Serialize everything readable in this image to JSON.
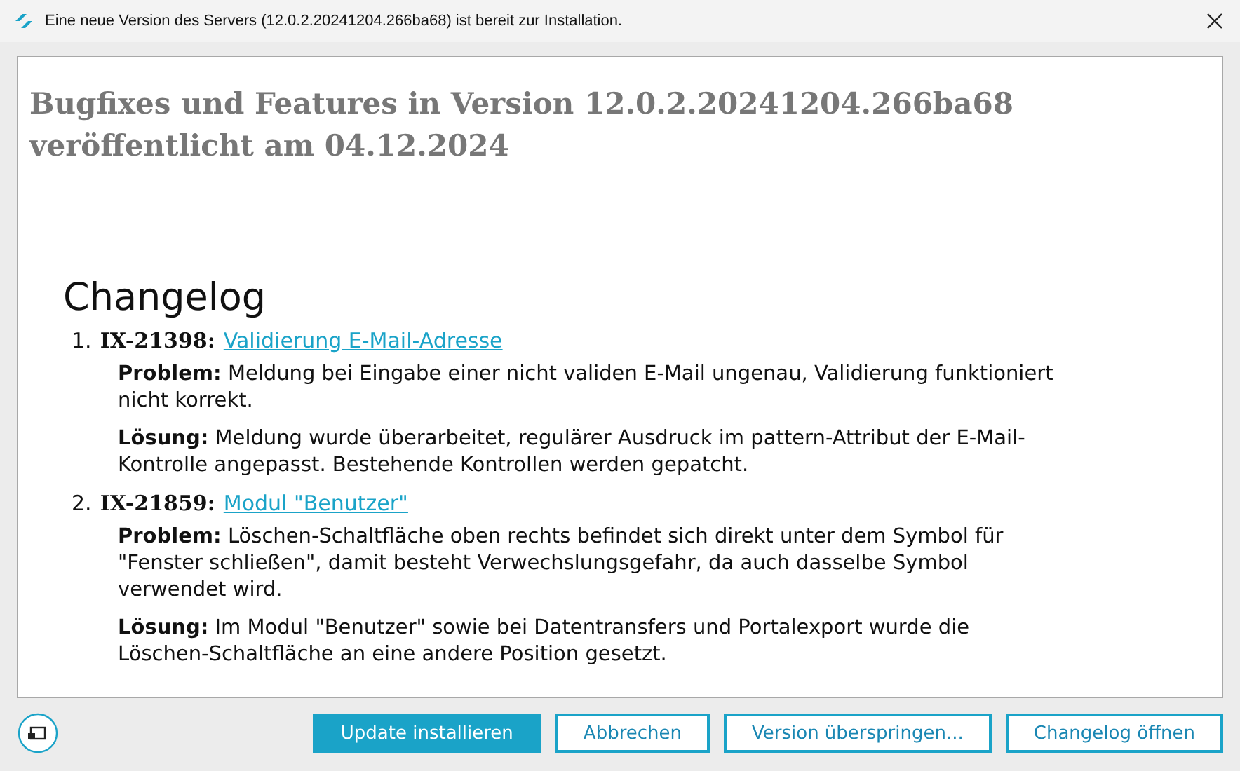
{
  "window": {
    "title": "Eine neue Version des Servers (12.0.2.20241204.266ba68) ist bereit zur Installation."
  },
  "release": {
    "heading": "Bugfixes und Features in Version 12.0.2.20241204.266ba68 veröffentlicht am 04.12.2024"
  },
  "changelog": {
    "title": "Changelog",
    "entries": [
      {
        "number": "1.",
        "id": "IX-21398:",
        "link": "Validierung E-Mail-Adresse",
        "paragraphs": [
          "**Problem:** Meldung bei Eingabe einer nicht validen E-Mail ungenau, Validierung funktioniert nicht korrekt.",
          "**Lösung:** Meldung wurde überarbeitet, regulärer Ausdruck im pattern-Attribut der E-Mail-Kontrolle angepasst. Bestehende Kontrollen werden gepatcht."
        ]
      },
      {
        "number": "2.",
        "id": "IX-21859:",
        "link": "Modul \"Benutzer\"",
        "paragraphs": [
          "**Problem:** Löschen-Schaltfläche oben rechts befindet sich direkt unter dem Symbol für \"Fenster schließen\", damit besteht Verwechslungsgefahr, da auch dasselbe Symbol verwendet wird.",
          "**Lösung:** Im Modul \"Benutzer\" sowie bei Datentransfers und Portalexport wurde die Löschen-Schaltfläche an eine andere Position gesetzt."
        ]
      }
    ]
  },
  "buttons": [
    {
      "label": "Update installieren",
      "kind": "primary"
    },
    {
      "label": "Abbrechen",
      "kind": "secondary"
    },
    {
      "label": "Version überspringen...",
      "kind": "secondary"
    },
    {
      "label": "Changelog öffnen",
      "kind": "secondary"
    }
  ]
}
